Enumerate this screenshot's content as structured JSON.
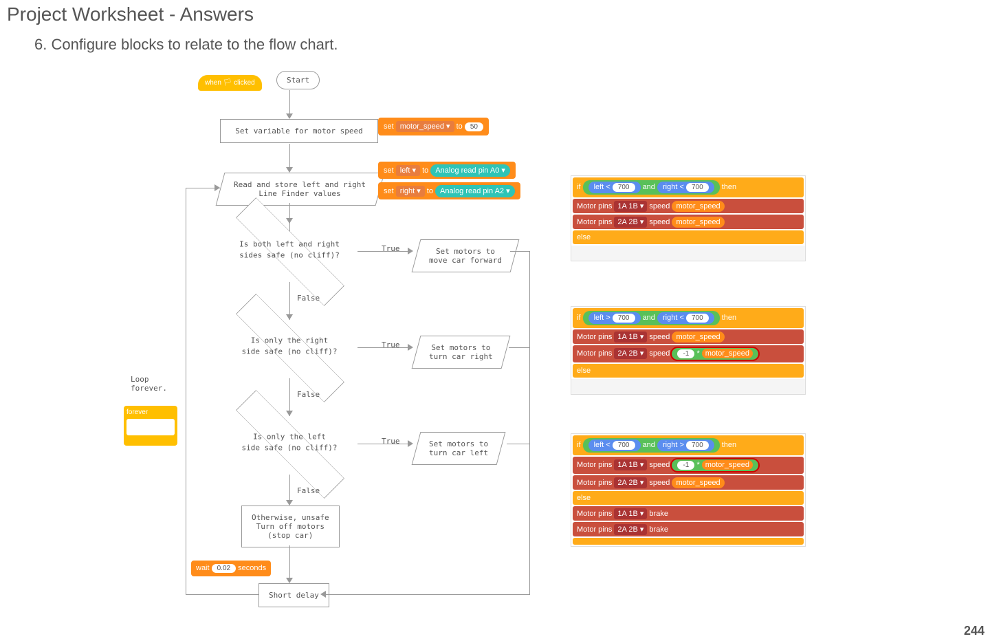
{
  "header": {
    "title": "Project Worksheet - Answers",
    "subtitle": "6. Configure blocks to relate to the flow chart."
  },
  "flowchart": {
    "start": "Start",
    "set_var": "Set variable for motor speed",
    "read_store": "Read and store left and right\nLine Finder values",
    "decision1": "Is both left and right\nsides safe (no cliff)?",
    "decision2": "Is only the right\nside safe (no cliff)?",
    "decision3": "Is only the left\nside safe (no cliff)?",
    "action1": "Set motors to\nmove car forward",
    "action2": "Set motors to\nturn car right",
    "action3": "Set motors to\nturn car left",
    "otherwise": "Otherwise, unsafe\nTurn off motors\n(stop car)",
    "delay": "Short delay",
    "true": "True",
    "false": "False",
    "loop": "Loop\nforever."
  },
  "scratch": {
    "when_clicked": "when 🏳 clicked",
    "set_motor_speed": {
      "pre": "set",
      "var": "motor_speed ▾",
      "to": "to",
      "val": "50"
    },
    "set_left": {
      "pre": "set",
      "var": "left ▾",
      "to": "to",
      "read": "Analog read pin",
      "pin": "A0 ▾"
    },
    "set_right": {
      "pre": "set",
      "var": "right ▾",
      "to": "to",
      "read": "Analog read pin",
      "pin": "A2 ▾"
    },
    "forever": "forever",
    "wait": {
      "w": "wait",
      "sec": "0.02",
      "s": "seconds"
    }
  },
  "code_blocks": {
    "block1": {
      "if": "if",
      "left": "left",
      "lt": "<",
      "v700": "700",
      "and": "and",
      "right": "right",
      "then": "then",
      "motor1": "Motor pins",
      "pins1": "1A 1B ▾",
      "speed": "speed",
      "ms": "motor_speed",
      "pins2": "2A 2B ▾",
      "else": "else"
    },
    "block2": {
      "if": "if",
      "left": "left",
      "gt": ">",
      "v700": "700",
      "and": "and",
      "right": "right",
      "lt": "<",
      "then": "then",
      "motor1": "Motor pins",
      "pins1": "1A 1B ▾",
      "speed": "speed",
      "ms": "motor_speed",
      "pins2": "2A 2B ▾",
      "neg": "-1",
      "mul": "*",
      "else": "else"
    },
    "block3": {
      "if": "if",
      "left": "left",
      "lt": "<",
      "v700": "700",
      "and": "and",
      "right": "right",
      "gt": ">",
      "then": "then",
      "motor1": "Motor pins",
      "pins1": "1A 1B ▾",
      "speed": "speed",
      "neg": "-1",
      "mul": "*",
      "ms": "motor_speed",
      "pins2": "2A 2B ▾",
      "else": "else",
      "brake": "brake"
    }
  },
  "page_number": "244"
}
